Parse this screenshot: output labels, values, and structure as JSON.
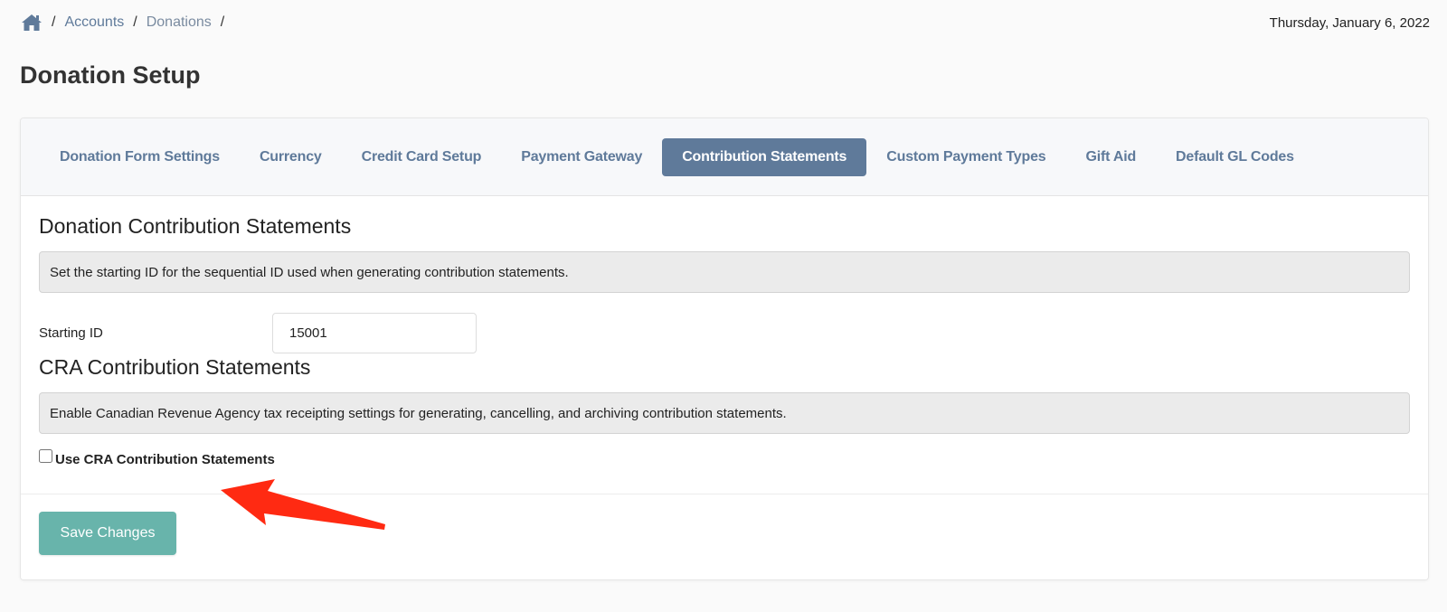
{
  "breadcrumb": {
    "home_icon": "home-icon",
    "items": [
      {
        "label": "Accounts"
      },
      {
        "label": "Donations"
      }
    ],
    "separator": "/"
  },
  "date": "Thursday, January 6, 2022",
  "page_title": "Donation Setup",
  "tabs": [
    {
      "label": "Donation Form Settings",
      "active": false
    },
    {
      "label": "Currency",
      "active": false
    },
    {
      "label": "Credit Card Setup",
      "active": false
    },
    {
      "label": "Payment Gateway",
      "active": false
    },
    {
      "label": "Contribution Statements",
      "active": true
    },
    {
      "label": "Custom Payment Types",
      "active": false
    },
    {
      "label": "Gift Aid",
      "active": false
    },
    {
      "label": "Default GL Codes",
      "active": false
    }
  ],
  "donation_section": {
    "title": "Donation Contribution Statements",
    "info": "Set the starting ID for the sequential ID used when generating contribution statements.",
    "starting_id_label": "Starting ID",
    "starting_id_value": "15001"
  },
  "cra_section": {
    "title": "CRA Contribution Statements",
    "info": "Enable Canadian Revenue Agency tax receipting settings for generating, cancelling, and archiving contribution statements.",
    "checkbox_label": "Use CRA Contribution Statements",
    "checkbox_checked": false
  },
  "footer": {
    "save_label": "Save Changes"
  },
  "annotation": {
    "arrow_icon": "red-arrow-annotation",
    "color": "#ff2a12"
  },
  "colors": {
    "accent": "#5f7a9a",
    "save_button": "#68b4ab",
    "info_box": "#ebebeb"
  }
}
